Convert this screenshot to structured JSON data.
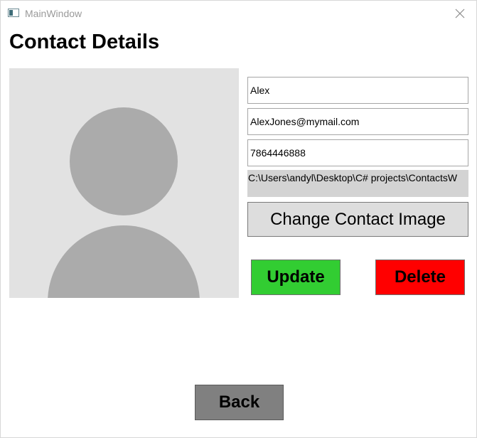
{
  "window": {
    "title": "MainWindow"
  },
  "page": {
    "title": "Contact Details"
  },
  "contact": {
    "name": "Alex",
    "email": "AlexJones@mymail.com",
    "phone": "7864446888",
    "image_path": "C:\\Users\\andyl\\Desktop\\C# projects\\ContactsW"
  },
  "buttons": {
    "change_image": "Change Contact Image",
    "update": "Update",
    "delete": "Delete",
    "back": "Back"
  },
  "colors": {
    "update": "#32cd32",
    "delete": "#ff0000",
    "back": "#808080",
    "avatar_bg": "#e2e2e2",
    "avatar_fg": "#ababab"
  },
  "icons": {
    "app": "app-window-icon",
    "close": "close-icon",
    "avatar": "person-placeholder-icon"
  }
}
